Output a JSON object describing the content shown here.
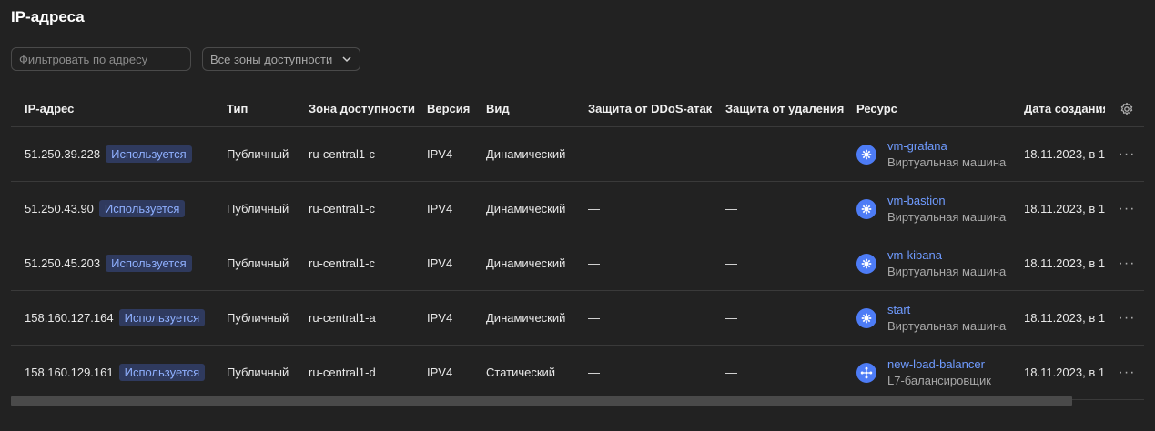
{
  "page": {
    "title": "IP-адреса"
  },
  "filters": {
    "address_placeholder": "Фильтровать по адресу",
    "zone_select_value": "Все зоны доступности"
  },
  "table": {
    "columns": [
      "IP-адрес",
      "Тип",
      "Зона доступности",
      "Версия",
      "Вид",
      "Защита от DDoS-атак",
      "Защита от удаления",
      "Ресурс",
      "Дата создания"
    ],
    "rows": [
      {
        "ip": "51.250.39.228",
        "status": "Используется",
        "type": "Публичный",
        "zone": "ru-central1-c",
        "version": "IPV4",
        "kind": "Динамический",
        "ddos": "—",
        "deletion": "—",
        "resource_name": "vm-grafana",
        "resource_type": "Виртуальная машина",
        "resource_icon": "virtual-machine-icon",
        "created": "18.11.2023, в 1"
      },
      {
        "ip": "51.250.43.90",
        "status": "Используется",
        "type": "Публичный",
        "zone": "ru-central1-c",
        "version": "IPV4",
        "kind": "Динамический",
        "ddos": "—",
        "deletion": "—",
        "resource_name": "vm-bastion",
        "resource_type": "Виртуальная машина",
        "resource_icon": "virtual-machine-icon",
        "created": "18.11.2023, в 1"
      },
      {
        "ip": "51.250.45.203",
        "status": "Используется",
        "type": "Публичный",
        "zone": "ru-central1-c",
        "version": "IPV4",
        "kind": "Динамический",
        "ddos": "—",
        "deletion": "—",
        "resource_name": "vm-kibana",
        "resource_type": "Виртуальная машина",
        "resource_icon": "virtual-machine-icon",
        "created": "18.11.2023, в 1"
      },
      {
        "ip": "158.160.127.164",
        "status": "Используется",
        "type": "Публичный",
        "zone": "ru-central1-a",
        "version": "IPV4",
        "kind": "Динамический",
        "ddos": "—",
        "deletion": "—",
        "resource_name": "start",
        "resource_type": "Виртуальная машина",
        "resource_icon": "virtual-machine-icon",
        "created": "18.11.2023, в 1"
      },
      {
        "ip": "158.160.129.161",
        "status": "Используется",
        "type": "Публичный",
        "zone": "ru-central1-d",
        "version": "IPV4",
        "kind": "Статический",
        "ddos": "—",
        "deletion": "—",
        "resource_name": "new-load-balancer",
        "resource_type": "L7-балансировщик",
        "resource_icon": "load-balancer-icon",
        "created": "18.11.2023, в 1"
      }
    ]
  },
  "colors": {
    "background": "#222222",
    "badge_bg": "#2f3a5e",
    "badge_text": "#8fb0ff",
    "link": "#6f9bff",
    "icon_bg": "#4d7cf6"
  }
}
